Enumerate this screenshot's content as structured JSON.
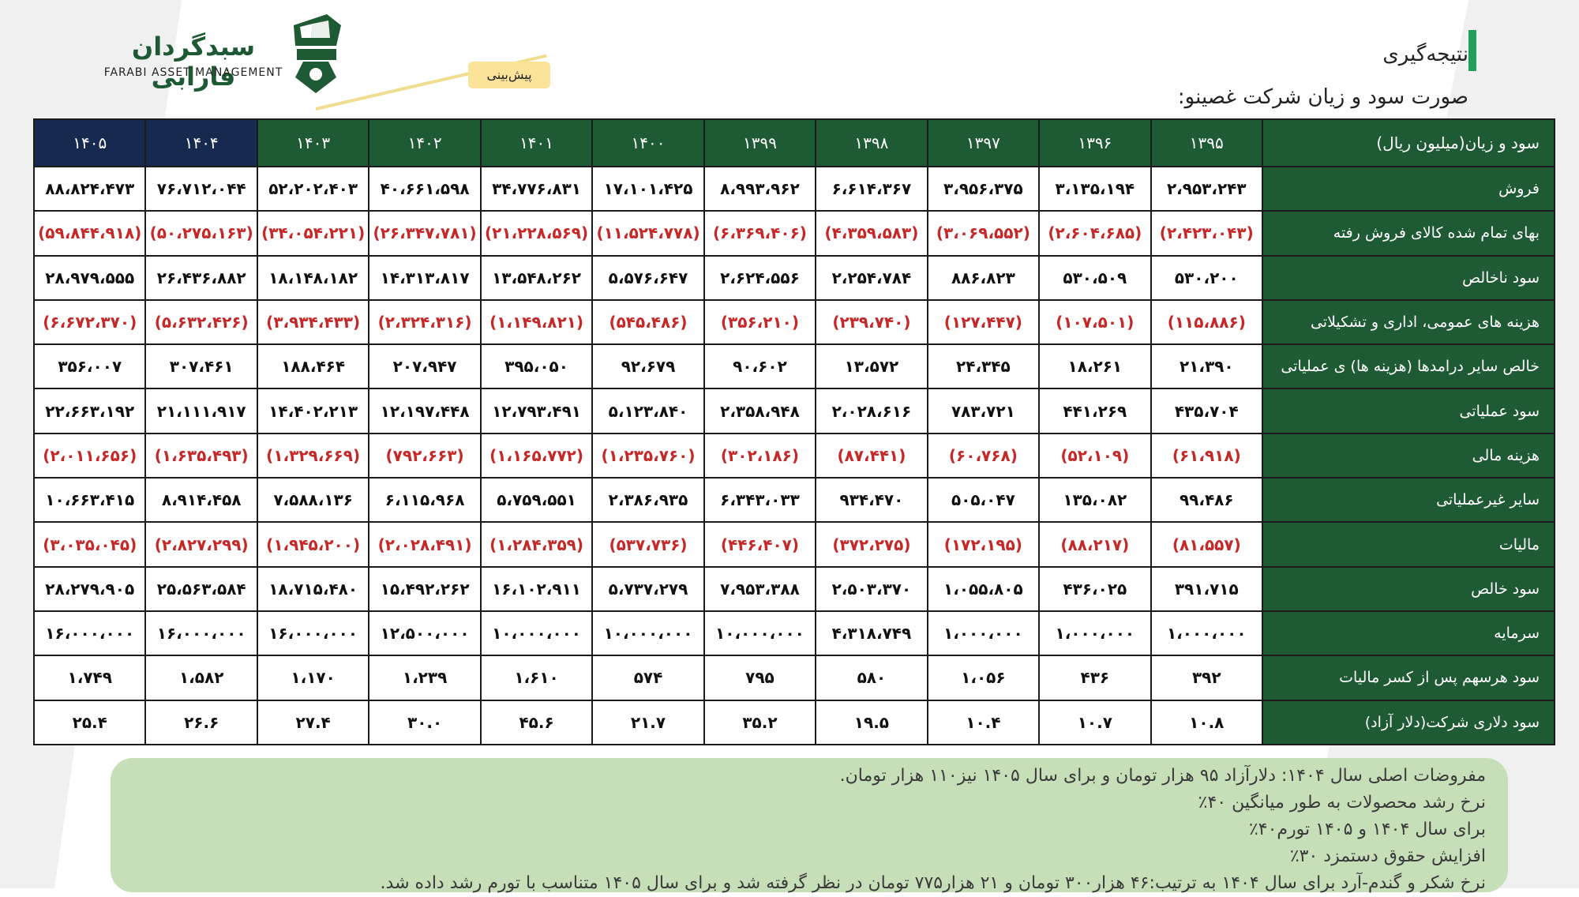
{
  "header": {
    "logo_name": "سبدگردان فارابی",
    "logo_sub": "FARABI ASSET MANAGEMENT",
    "forecast_tag": "پیش‌بینی",
    "section_title": "نتیجه‌گیری",
    "subtitle": "صورت سود و زیان شرکت غصینو:"
  },
  "colors": {
    "header_green": "#1e5a33",
    "header_navy": "#16294f",
    "negative": "#c62828",
    "assumption_bg": "#c6dfb8",
    "accent_bar": "#22a05a"
  },
  "table": {
    "corner": "سود و زیان(میلیون ریال)",
    "years": [
      "۱۳۹۵",
      "۱۳۹۶",
      "۱۳۹۷",
      "۱۳۹۸",
      "۱۳۹۹",
      "۱۴۰۰",
      "۱۴۰۱",
      "۱۴۰۲",
      "۱۴۰۳",
      "۱۴۰۴",
      "۱۴۰۵"
    ],
    "rows": [
      {
        "label": "فروش",
        "neg": false,
        "values": [
          "۲،۹۵۳،۲۴۳",
          "۳،۱۳۵،۱۹۴",
          "۳،۹۵۶،۳۷۵",
          "۶،۶۱۴،۳۶۷",
          "۸،۹۹۳،۹۶۲",
          "۱۷،۱۰۱،۴۲۵",
          "۳۴،۷۷۶،۸۳۱",
          "۴۰،۶۶۱،۵۹۸",
          "۵۲،۲۰۲،۴۰۳",
          "۷۶،۷۱۲،۰۴۴",
          "۸۸،۸۲۴،۴۷۳"
        ]
      },
      {
        "label": "بهای تمام شده کالای فروش رفته",
        "neg": true,
        "values": [
          "(۲،۴۲۳،۰۴۳)",
          "(۲،۶۰۴،۶۸۵)",
          "(۳،۰۶۹،۵۵۲)",
          "(۴،۳۵۹،۵۸۳)",
          "(۶،۳۶۹،۴۰۶)",
          "(۱۱،۵۲۴،۷۷۸)",
          "(۲۱،۲۲۸،۵۶۹)",
          "(۲۶،۳۴۷،۷۸۱)",
          "(۳۴،۰۵۴،۲۲۱)",
          "(۵۰،۲۷۵،۱۶۳)",
          "(۵۹،۸۴۴،۹۱۸)"
        ]
      },
      {
        "label": "سود ناخالص",
        "neg": false,
        "values": [
          "۵۳۰،۲۰۰",
          "۵۳۰،۵۰۹",
          "۸۸۶،۸۲۳",
          "۲،۲۵۴،۷۸۴",
          "۲،۶۲۴،۵۵۶",
          "۵،۵۷۶،۶۴۷",
          "۱۳،۵۴۸،۲۶۲",
          "۱۴،۳۱۳،۸۱۷",
          "۱۸،۱۴۸،۱۸۲",
          "۲۶،۴۳۶،۸۸۲",
          "۲۸،۹۷۹،۵۵۵"
        ]
      },
      {
        "label": "هزینه های عمومی، اداری و تشکیلاتی",
        "neg": true,
        "values": [
          "(۱۱۵،۸۸۶)",
          "(۱۰۷،۵۰۱)",
          "(۱۲۷،۴۴۷)",
          "(۲۳۹،۷۴۰)",
          "(۳۵۶،۲۱۰)",
          "(۵۴۵،۴۸۶)",
          "(۱،۱۴۹،۸۲۱)",
          "(۲،۳۲۴،۳۱۶)",
          "(۳،۹۳۴،۴۳۳)",
          "(۵،۶۳۲،۴۲۶)",
          "(۶،۶۷۲،۳۷۰)"
        ]
      },
      {
        "label": "خالص سایر درامدها (هزینه ها) ی عملیاتی",
        "neg": false,
        "values": [
          "۲۱،۳۹۰",
          "۱۸،۲۶۱",
          "۲۴،۳۴۵",
          "۱۳،۵۷۲",
          "۹۰،۶۰۲",
          "۹۲،۶۷۹",
          "۳۹۵،۰۵۰",
          "۲۰۷،۹۴۷",
          "۱۸۸،۴۶۴",
          "۳۰۷،۴۶۱",
          "۳۵۶،۰۰۷"
        ]
      },
      {
        "label": "سود عملیاتی",
        "neg": false,
        "values": [
          "۴۳۵،۷۰۴",
          "۴۴۱،۲۶۹",
          "۷۸۳،۷۲۱",
          "۲،۰۲۸،۶۱۶",
          "۲،۳۵۸،۹۴۸",
          "۵،۱۲۳،۸۴۰",
          "۱۲،۷۹۳،۴۹۱",
          "۱۲،۱۹۷،۴۴۸",
          "۱۴،۴۰۲،۲۱۳",
          "۲۱،۱۱۱،۹۱۷",
          "۲۲،۶۶۳،۱۹۲"
        ]
      },
      {
        "label": "هزینه مالی",
        "neg": true,
        "values": [
          "(۶۱،۹۱۸)",
          "(۵۲،۱۰۹)",
          "(۶۰،۷۶۸)",
          "(۸۷،۴۴۱)",
          "(۳۰۲،۱۸۶)",
          "(۱،۲۳۵،۷۶۰)",
          "(۱،۱۶۵،۷۷۲)",
          "(۷۹۲،۶۶۳)",
          "(۱،۳۲۹،۶۶۹)",
          "(۱،۶۳۵،۴۹۳)",
          "(۲،۰۱۱،۶۵۶)"
        ]
      },
      {
        "label": "سایر غیرعملیاتی",
        "neg": false,
        "values": [
          "۹۹،۴۸۶",
          "۱۳۵،۰۸۲",
          "۵۰۵،۰۴۷",
          "۹۳۴،۴۷۰",
          "۶،۳۴۳،۰۳۳",
          "۲،۳۸۶،۹۳۵",
          "۵،۷۵۹،۵۵۱",
          "۶،۱۱۵،۹۶۸",
          "۷،۵۸۸،۱۳۶",
          "۸،۹۱۴،۴۵۸",
          "۱۰،۶۶۳،۴۱۵"
        ]
      },
      {
        "label": "مالیات",
        "neg": true,
        "values": [
          "(۸۱،۵۵۷)",
          "(۸۸،۲۱۷)",
          "(۱۷۲،۱۹۵)",
          "(۳۷۲،۲۷۵)",
          "(۴۴۶،۴۰۷)",
          "(۵۳۷،۷۳۶)",
          "(۱،۲۸۴،۳۵۹)",
          "(۲،۰۲۸،۴۹۱)",
          "(۱،۹۴۵،۲۰۰)",
          "(۲،۸۲۷،۲۹۹)",
          "(۳،۰۳۵،۰۴۵)"
        ]
      },
      {
        "label": "سود خالص",
        "neg": false,
        "values": [
          "۳۹۱،۷۱۵",
          "۴۳۶،۰۲۵",
          "۱،۰۵۵،۸۰۵",
          "۲،۵۰۳،۳۷۰",
          "۷،۹۵۳،۳۸۸",
          "۵،۷۳۷،۲۷۹",
          "۱۶،۱۰۲،۹۱۱",
          "۱۵،۴۹۲،۲۶۲",
          "۱۸،۷۱۵،۴۸۰",
          "۲۵،۵۶۳،۵۸۴",
          "۲۸،۲۷۹،۹۰۵"
        ]
      },
      {
        "label": "سرمایه",
        "neg": false,
        "values": [
          "۱،۰۰۰،۰۰۰",
          "۱،۰۰۰،۰۰۰",
          "۱،۰۰۰،۰۰۰",
          "۴،۳۱۸،۷۴۹",
          "۱۰،۰۰۰،۰۰۰",
          "۱۰،۰۰۰،۰۰۰",
          "۱۰،۰۰۰،۰۰۰",
          "۱۲،۵۰۰،۰۰۰",
          "۱۶،۰۰۰،۰۰۰",
          "۱۶،۰۰۰،۰۰۰",
          "۱۶،۰۰۰،۰۰۰"
        ]
      },
      {
        "label": "سود هرسهم پس از کسر مالیات",
        "neg": false,
        "values": [
          "۳۹۲",
          "۴۳۶",
          "۱،۰۵۶",
          "۵۸۰",
          "۷۹۵",
          "۵۷۴",
          "۱،۶۱۰",
          "۱،۲۳۹",
          "۱،۱۷۰",
          "۱،۵۸۲",
          "۱،۷۴۹"
        ]
      },
      {
        "label": "سود دلاری شرکت(دلار آزاد)",
        "neg": false,
        "values": [
          "۱۰.۸",
          "۱۰.۷",
          "۱۰.۴",
          "۱۹.۵",
          "۳۵.۲",
          "۲۱.۷",
          "۴۵.۶",
          "۳۰.۰",
          "۲۷.۴",
          "۲۶.۶",
          "۲۵.۴"
        ]
      }
    ]
  },
  "assumptions": [
    "مفروضات اصلی سال ۱۴۰۴: دلارآزاد ۹۵ هزار تومان و برای سال ۱۴۰۵ نیز۱۱۰ هزار تومان.",
    "نرخ رشد محصولات به طور میانگین ۴۰٪",
    "برای سال ۱۴۰۴ و ۱۴۰۵ تورم۴۰٪",
    "افزایش  حقوق دستمزد ۳۰٪",
    "نرخ شکر و گندم-آرد برای سال ۱۴۰۴ به ترتیب:۴۶ هزار۳۰۰ تومان و ۲۱ هزار۷۷۵ تومان در نظر گرفته شد و برای سال ۱۴۰۵ متناسب با تورم رشد داده شد."
  ]
}
